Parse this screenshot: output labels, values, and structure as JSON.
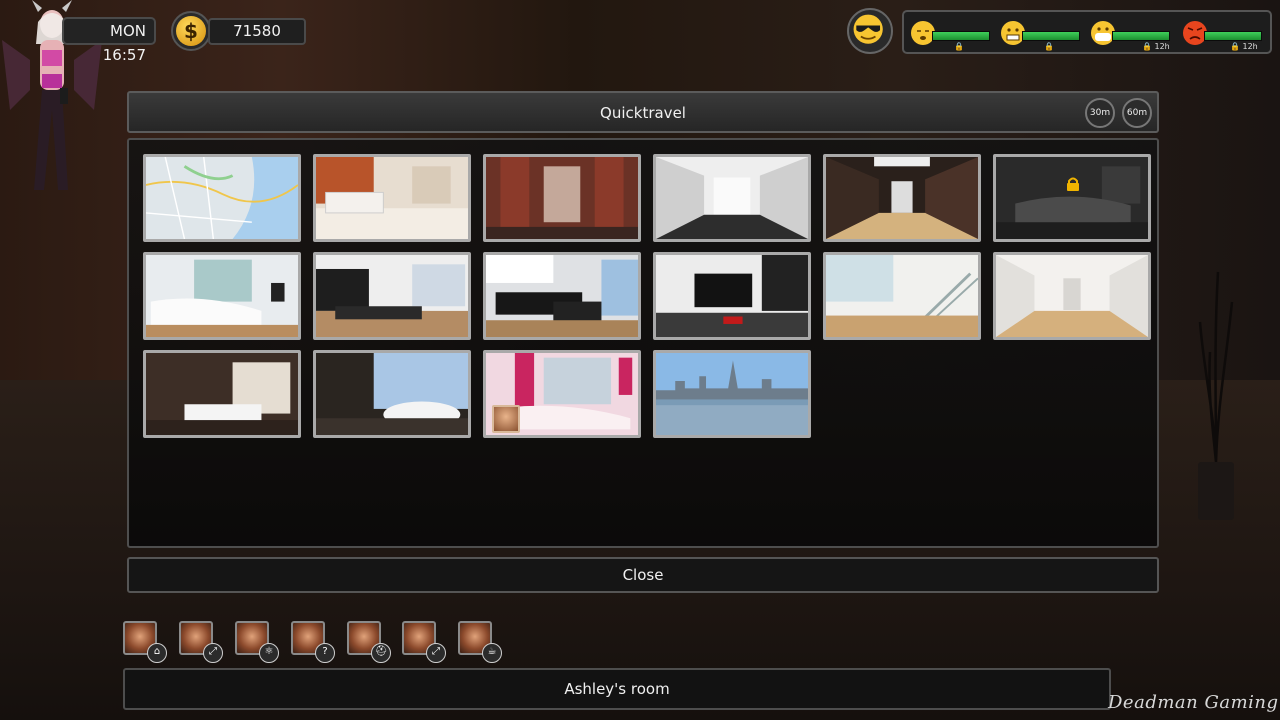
{
  "hud": {
    "day_time": "MON 16:57",
    "money_symbol": "$",
    "money": "71580",
    "mood_icon": "cool-sunglasses-face-icon",
    "stats": [
      {
        "icon": "sleepy-face-icon",
        "level": 1.0,
        "sub": "🔒"
      },
      {
        "icon": "gritted-teeth-face-icon",
        "level": 1.0,
        "sub": "🔒"
      },
      {
        "icon": "mask-face-icon",
        "level": 1.0,
        "sub": "🔒 12h"
      },
      {
        "icon": "angry-face-icon",
        "level": 1.0,
        "sub": "🔒 12h"
      }
    ],
    "bar_color": "#2db54a"
  },
  "quicktravel": {
    "title": "Quicktravel",
    "buttons": [
      "30m",
      "60m"
    ],
    "locations": [
      {
        "scene": "city-map",
        "locked": false
      },
      {
        "scene": "lobby-reception",
        "locked": false
      },
      {
        "scene": "elevator-hall",
        "locked": false
      },
      {
        "scene": "white-hallway",
        "locked": false
      },
      {
        "scene": "dark-hallway",
        "locked": false
      },
      {
        "scene": "dark-bedroom",
        "locked": true
      },
      {
        "scene": "white-bedroom",
        "locked": false
      },
      {
        "scene": "living-room",
        "locked": false
      },
      {
        "scene": "kitchen",
        "locked": false
      },
      {
        "scene": "tv-lounge",
        "locked": false
      },
      {
        "scene": "stair-loft",
        "locked": false
      },
      {
        "scene": "beige-hallway",
        "locked": false
      },
      {
        "scene": "brown-bedroom",
        "locked": false
      },
      {
        "scene": "bathroom-jacuzzi",
        "locked": false
      },
      {
        "scene": "pink-bedroom",
        "locked": false,
        "occupant": true
      },
      {
        "scene": "city-skyline",
        "locked": false
      }
    ]
  },
  "close_label": "Close",
  "contacts": [
    {
      "badge": "⌂",
      "badge_icon": "home-icon"
    },
    {
      "badge": "⤢",
      "badge_icon": "expand-arrows-icon"
    },
    {
      "badge": "⚛",
      "badge_icon": "atom-icon"
    },
    {
      "badge": "?",
      "badge_icon": "question-icon"
    },
    {
      "badge": "⛑",
      "badge_icon": "police-cap-icon"
    },
    {
      "badge": "⤢",
      "badge_icon": "expand-arrows-icon"
    },
    {
      "badge": "☕",
      "badge_icon": "cup-icon"
    }
  ],
  "current_location": "Ashley's room",
  "watermark": "Deadman Gaming"
}
